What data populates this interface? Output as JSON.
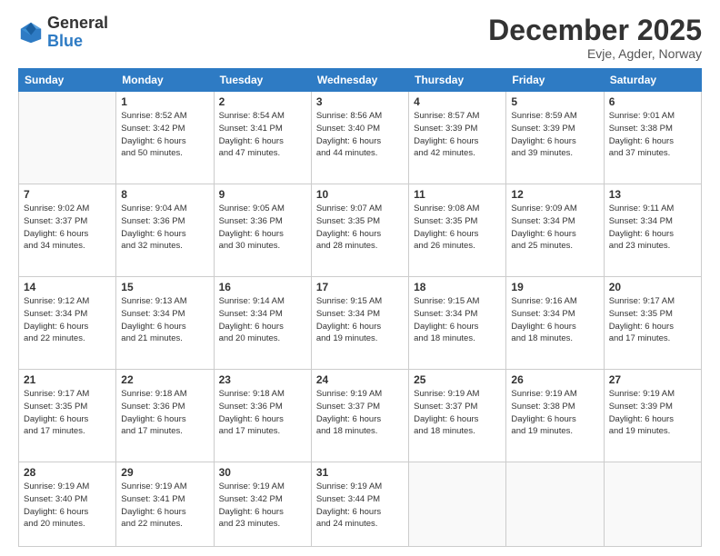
{
  "logo": {
    "general": "General",
    "blue": "Blue"
  },
  "title": "December 2025",
  "location": "Evje, Agder, Norway",
  "days_header": [
    "Sunday",
    "Monday",
    "Tuesday",
    "Wednesday",
    "Thursday",
    "Friday",
    "Saturday"
  ],
  "weeks": [
    [
      {
        "num": "",
        "info": ""
      },
      {
        "num": "1",
        "info": "Sunrise: 8:52 AM\nSunset: 3:42 PM\nDaylight: 6 hours\nand 50 minutes."
      },
      {
        "num": "2",
        "info": "Sunrise: 8:54 AM\nSunset: 3:41 PM\nDaylight: 6 hours\nand 47 minutes."
      },
      {
        "num": "3",
        "info": "Sunrise: 8:56 AM\nSunset: 3:40 PM\nDaylight: 6 hours\nand 44 minutes."
      },
      {
        "num": "4",
        "info": "Sunrise: 8:57 AM\nSunset: 3:39 PM\nDaylight: 6 hours\nand 42 minutes."
      },
      {
        "num": "5",
        "info": "Sunrise: 8:59 AM\nSunset: 3:39 PM\nDaylight: 6 hours\nand 39 minutes."
      },
      {
        "num": "6",
        "info": "Sunrise: 9:01 AM\nSunset: 3:38 PM\nDaylight: 6 hours\nand 37 minutes."
      }
    ],
    [
      {
        "num": "7",
        "info": "Sunrise: 9:02 AM\nSunset: 3:37 PM\nDaylight: 6 hours\nand 34 minutes."
      },
      {
        "num": "8",
        "info": "Sunrise: 9:04 AM\nSunset: 3:36 PM\nDaylight: 6 hours\nand 32 minutes."
      },
      {
        "num": "9",
        "info": "Sunrise: 9:05 AM\nSunset: 3:36 PM\nDaylight: 6 hours\nand 30 minutes."
      },
      {
        "num": "10",
        "info": "Sunrise: 9:07 AM\nSunset: 3:35 PM\nDaylight: 6 hours\nand 28 minutes."
      },
      {
        "num": "11",
        "info": "Sunrise: 9:08 AM\nSunset: 3:35 PM\nDaylight: 6 hours\nand 26 minutes."
      },
      {
        "num": "12",
        "info": "Sunrise: 9:09 AM\nSunset: 3:34 PM\nDaylight: 6 hours\nand 25 minutes."
      },
      {
        "num": "13",
        "info": "Sunrise: 9:11 AM\nSunset: 3:34 PM\nDaylight: 6 hours\nand 23 minutes."
      }
    ],
    [
      {
        "num": "14",
        "info": "Sunrise: 9:12 AM\nSunset: 3:34 PM\nDaylight: 6 hours\nand 22 minutes."
      },
      {
        "num": "15",
        "info": "Sunrise: 9:13 AM\nSunset: 3:34 PM\nDaylight: 6 hours\nand 21 minutes."
      },
      {
        "num": "16",
        "info": "Sunrise: 9:14 AM\nSunset: 3:34 PM\nDaylight: 6 hours\nand 20 minutes."
      },
      {
        "num": "17",
        "info": "Sunrise: 9:15 AM\nSunset: 3:34 PM\nDaylight: 6 hours\nand 19 minutes."
      },
      {
        "num": "18",
        "info": "Sunrise: 9:15 AM\nSunset: 3:34 PM\nDaylight: 6 hours\nand 18 minutes."
      },
      {
        "num": "19",
        "info": "Sunrise: 9:16 AM\nSunset: 3:34 PM\nDaylight: 6 hours\nand 18 minutes."
      },
      {
        "num": "20",
        "info": "Sunrise: 9:17 AM\nSunset: 3:35 PM\nDaylight: 6 hours\nand 17 minutes."
      }
    ],
    [
      {
        "num": "21",
        "info": "Sunrise: 9:17 AM\nSunset: 3:35 PM\nDaylight: 6 hours\nand 17 minutes."
      },
      {
        "num": "22",
        "info": "Sunrise: 9:18 AM\nSunset: 3:36 PM\nDaylight: 6 hours\nand 17 minutes."
      },
      {
        "num": "23",
        "info": "Sunrise: 9:18 AM\nSunset: 3:36 PM\nDaylight: 6 hours\nand 17 minutes."
      },
      {
        "num": "24",
        "info": "Sunrise: 9:19 AM\nSunset: 3:37 PM\nDaylight: 6 hours\nand 18 minutes."
      },
      {
        "num": "25",
        "info": "Sunrise: 9:19 AM\nSunset: 3:37 PM\nDaylight: 6 hours\nand 18 minutes."
      },
      {
        "num": "26",
        "info": "Sunrise: 9:19 AM\nSunset: 3:38 PM\nDaylight: 6 hours\nand 19 minutes."
      },
      {
        "num": "27",
        "info": "Sunrise: 9:19 AM\nSunset: 3:39 PM\nDaylight: 6 hours\nand 19 minutes."
      }
    ],
    [
      {
        "num": "28",
        "info": "Sunrise: 9:19 AM\nSunset: 3:40 PM\nDaylight: 6 hours\nand 20 minutes."
      },
      {
        "num": "29",
        "info": "Sunrise: 9:19 AM\nSunset: 3:41 PM\nDaylight: 6 hours\nand 22 minutes."
      },
      {
        "num": "30",
        "info": "Sunrise: 9:19 AM\nSunset: 3:42 PM\nDaylight: 6 hours\nand 23 minutes."
      },
      {
        "num": "31",
        "info": "Sunrise: 9:19 AM\nSunset: 3:44 PM\nDaylight: 6 hours\nand 24 minutes."
      },
      {
        "num": "",
        "info": ""
      },
      {
        "num": "",
        "info": ""
      },
      {
        "num": "",
        "info": ""
      }
    ]
  ]
}
